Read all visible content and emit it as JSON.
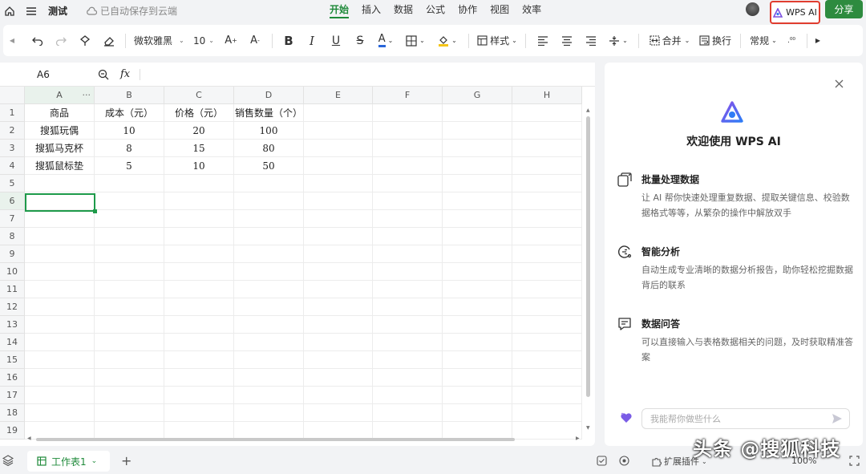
{
  "topbar": {
    "doc_title": "测试",
    "save_status": "已自动保存到云端",
    "tabs": [
      "开始",
      "插入",
      "数据",
      "公式",
      "协作",
      "视图",
      "效率"
    ],
    "active_tab": "开始",
    "wps_ai_label": "WPS AI",
    "share_label": "分享"
  },
  "toolbar": {
    "font_name": "微软雅黑",
    "font_size": "10",
    "style_label": "样式",
    "merge_label": "合并",
    "wrap_label": "换行",
    "number_format": "常规"
  },
  "formula_bar": {
    "cell_ref": "A6",
    "fx_label": "fx"
  },
  "grid": {
    "columns": [
      "A",
      "B",
      "C",
      "D",
      "E",
      "F",
      "G",
      "H"
    ],
    "rows": [
      "1",
      "2",
      "3",
      "4",
      "5",
      "6",
      "7",
      "8",
      "9",
      "10",
      "11",
      "12",
      "13",
      "14",
      "15",
      "16",
      "17",
      "18",
      "19"
    ],
    "cells": [
      [
        "商品",
        "成本（元）",
        "价格（元）",
        "销售数量（个）"
      ],
      [
        "搜狐玩偶",
        "10",
        "20",
        "100"
      ],
      [
        "搜狐马克杯",
        "8",
        "15",
        "80"
      ],
      [
        "搜狐鼠标垫",
        "5",
        "10",
        "50"
      ]
    ],
    "selected_cell": "A6"
  },
  "ai_panel": {
    "title": "欢迎使用 WPS AI",
    "features": [
      {
        "icon": "batch-process-icon",
        "title": "批量处理数据",
        "desc": "让 AI 帮你快速处理重复数据、提取关键信息、校验数据格式等等，从繁杂的操作中解放双手"
      },
      {
        "icon": "smart-analysis-icon",
        "title": "智能分析",
        "desc": "自动生成专业清晰的数据分析报告，助你轻松挖掘数据背后的联系"
      },
      {
        "icon": "data-qa-icon",
        "title": "数据问答",
        "desc": "可以直接输入与表格数据相关的问题，及时获取精准答案"
      }
    ],
    "input_placeholder": "我能帮你做些什么"
  },
  "bottombar": {
    "sheet_tab": "工作表1",
    "ext_plugin": "扩展插件",
    "zoom": "100%"
  },
  "watermark": "头条 @搜狐科技",
  "colors": {
    "accent": "#1f8a3a",
    "highlight_border": "#e03d2f"
  }
}
